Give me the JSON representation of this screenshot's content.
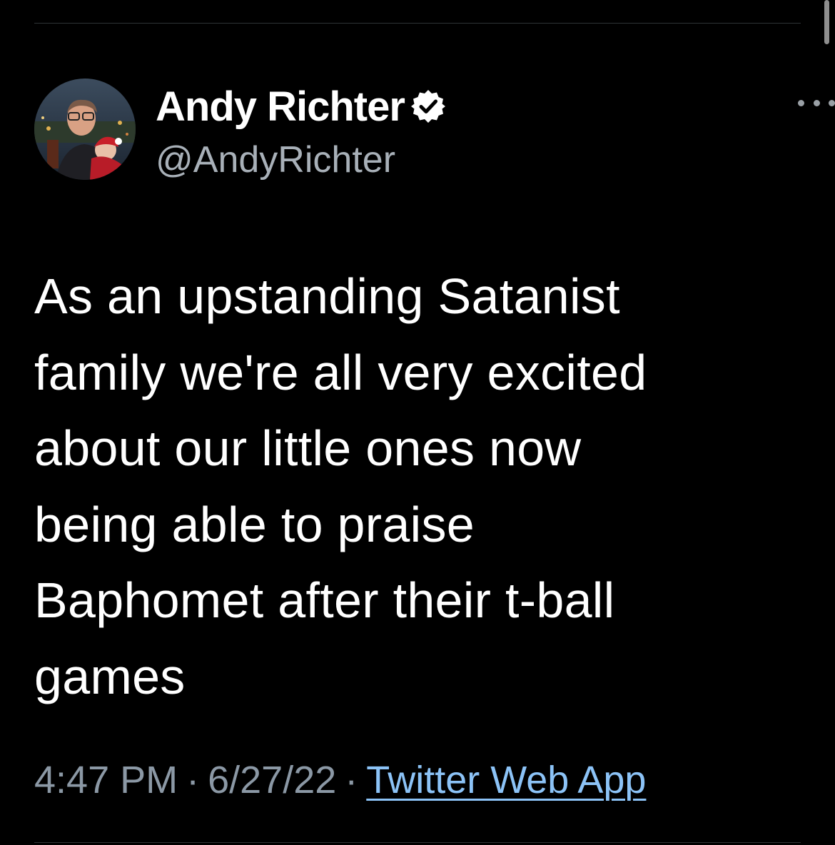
{
  "tweet": {
    "author": {
      "display_name": "Andy Richter",
      "handle": "@AndyRichter",
      "verified": true,
      "verified_icon": "verified-badge-icon",
      "avatar": "profile-photo"
    },
    "more_icon": "more-options-icon",
    "text": "As an upstanding Satanist\nfamily we're all very excited\nabout our little ones now\nbeing able to praise\nBaphomet after their t-ball\ngames",
    "time": "4:47 PM",
    "date": "6/27/22",
    "separator": "·",
    "source": "Twitter Web App"
  },
  "colors": {
    "background": "#000000",
    "text": "#ffffff",
    "secondary_text": "#8b98a5",
    "link": "#8cc3f7",
    "divider": "#2f3336"
  }
}
